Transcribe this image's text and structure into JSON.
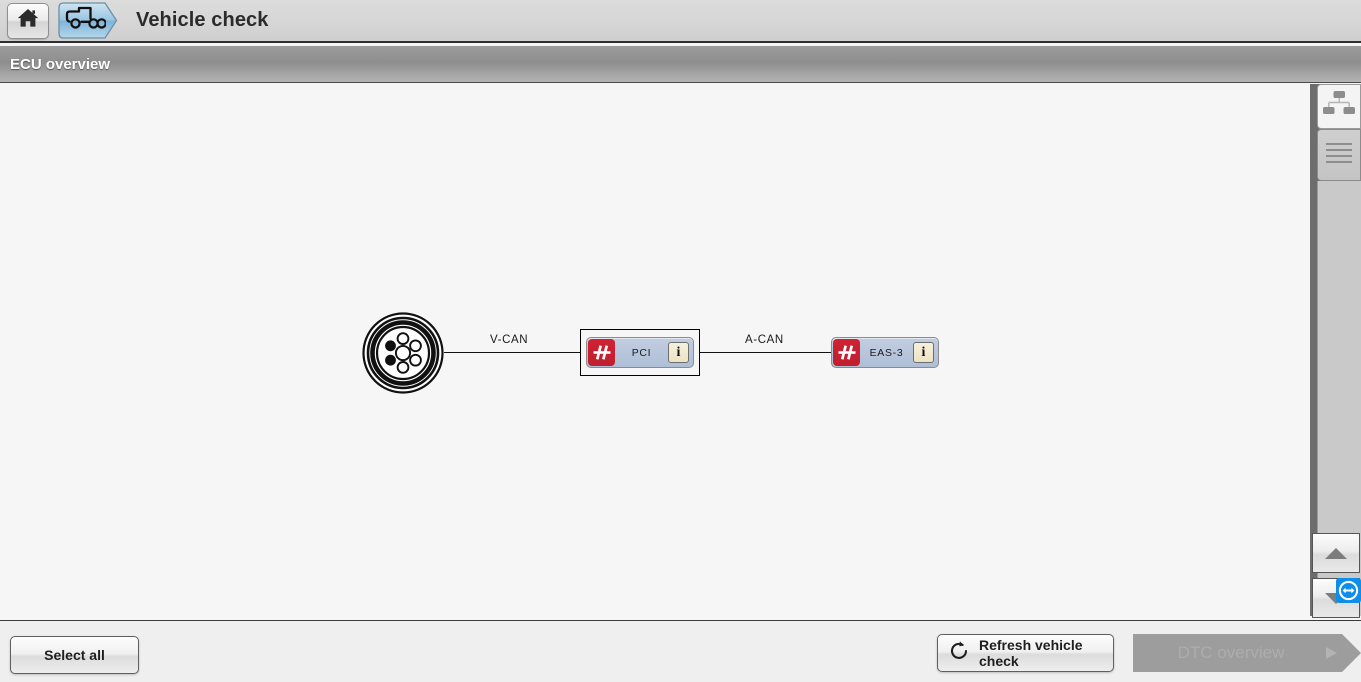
{
  "titlebar": {
    "home_icon": "home-icon",
    "vehicle_icon": "vehicle-truck-icon",
    "title": "Vehicle check"
  },
  "section": {
    "title": "ECU overview"
  },
  "diagram": {
    "connector_icon": "diagnostic-connector-icon",
    "buses": [
      {
        "label": "V-CAN"
      },
      {
        "label": "A-CAN"
      }
    ],
    "nodes": [
      {
        "name": "PCI",
        "status_icon": "broken-connection-icon",
        "status_color": "#c72030",
        "info_label": "i",
        "selected": true
      },
      {
        "name": "EAS-3",
        "status_icon": "broken-connection-icon",
        "status_color": "#c72030",
        "info_label": "i",
        "selected": false
      }
    ]
  },
  "right_panel": {
    "tools": [
      {
        "icon": "hierarchy-tree-view-icon",
        "active": true
      },
      {
        "icon": "list-view-icon",
        "active": false
      }
    ],
    "scroll_up_icon": "triangle-up-icon",
    "scroll_down_icon": "triangle-down-icon",
    "overlay_icon": "teamviewer-icon"
  },
  "bottombar": {
    "select_all_label": "Select all",
    "refresh_label": "Refresh vehicle check",
    "refresh_icon": "refresh-circular-arrow-icon",
    "dtc_label": "DTC overview",
    "dtc_disabled": true
  },
  "colors": {
    "accent_red": "#c72030",
    "node_blue": "#b8c6dc",
    "teamviewer_blue": "#0e8ee9",
    "canvas_bg": "#f6f6f6"
  }
}
